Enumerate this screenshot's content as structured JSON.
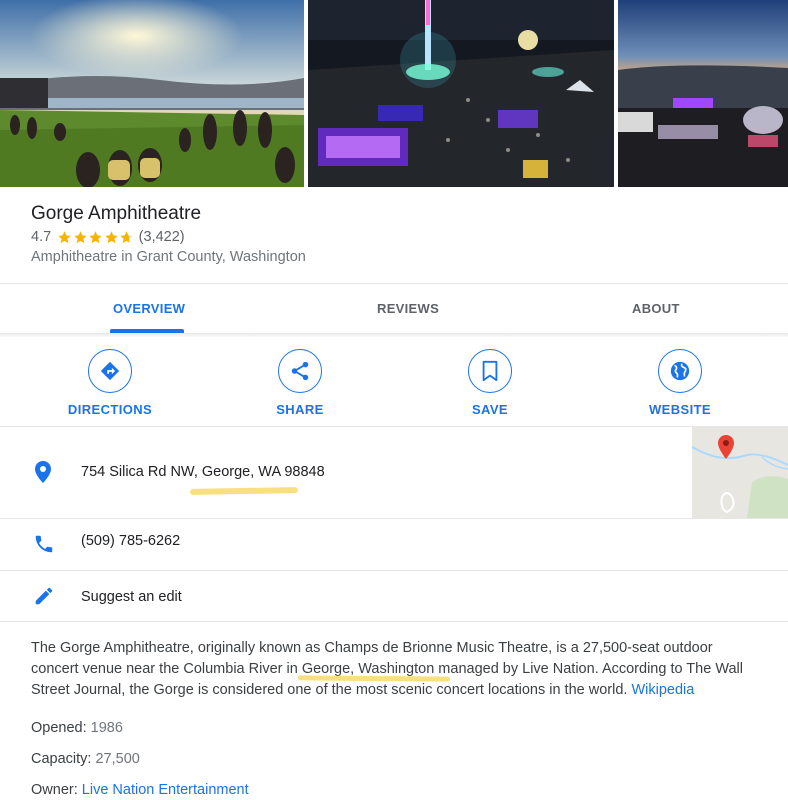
{
  "place": {
    "name": "Gorge Amphitheatre",
    "rating": "4.7",
    "rating_value": 4.7,
    "reviews_count": "(3,422)",
    "category": "Amphitheatre in Grant County, Washington"
  },
  "tabs": [
    {
      "label": "OVERVIEW",
      "active": true
    },
    {
      "label": "REVIEWS",
      "active": false
    },
    {
      "label": "ABOUT",
      "active": false
    }
  ],
  "actions": [
    {
      "label": "DIRECTIONS",
      "icon": "directions-icon"
    },
    {
      "label": "SHARE",
      "icon": "share-icon"
    },
    {
      "label": "SAVE",
      "icon": "bookmark-icon"
    },
    {
      "label": "WEBSITE",
      "icon": "globe-icon"
    }
  ],
  "info": {
    "address": "754 Silica Rd NW, George, WA 98848",
    "phone": "(509) 785-6262",
    "suggest_edit": "Suggest an edit"
  },
  "description": {
    "part1": "The Gorge Amphitheatre, originally known as Champs de Brionne Music Theatre, is a 27,500-seat outdoor concert venue near the Columbia River in ",
    "highlighted": "George, Washington",
    "part2": " managed by Live Nation. According to The Wall Street Journal, the Gorge is considered one of the most scenic concert locations in the world. ",
    "source_link": "Wikipedia"
  },
  "facts": {
    "opened_label": "Opened:",
    "opened_value": "1986",
    "capacity_label": "Capacity:",
    "capacity_value": "27,500",
    "owner_label": "Owner:",
    "owner_value": "Live Nation Entertainment"
  },
  "colors": {
    "accent": "#1a73e8",
    "star": "#f4b400",
    "highlight": "#f7d96a",
    "map_pin": "#ea4335"
  }
}
